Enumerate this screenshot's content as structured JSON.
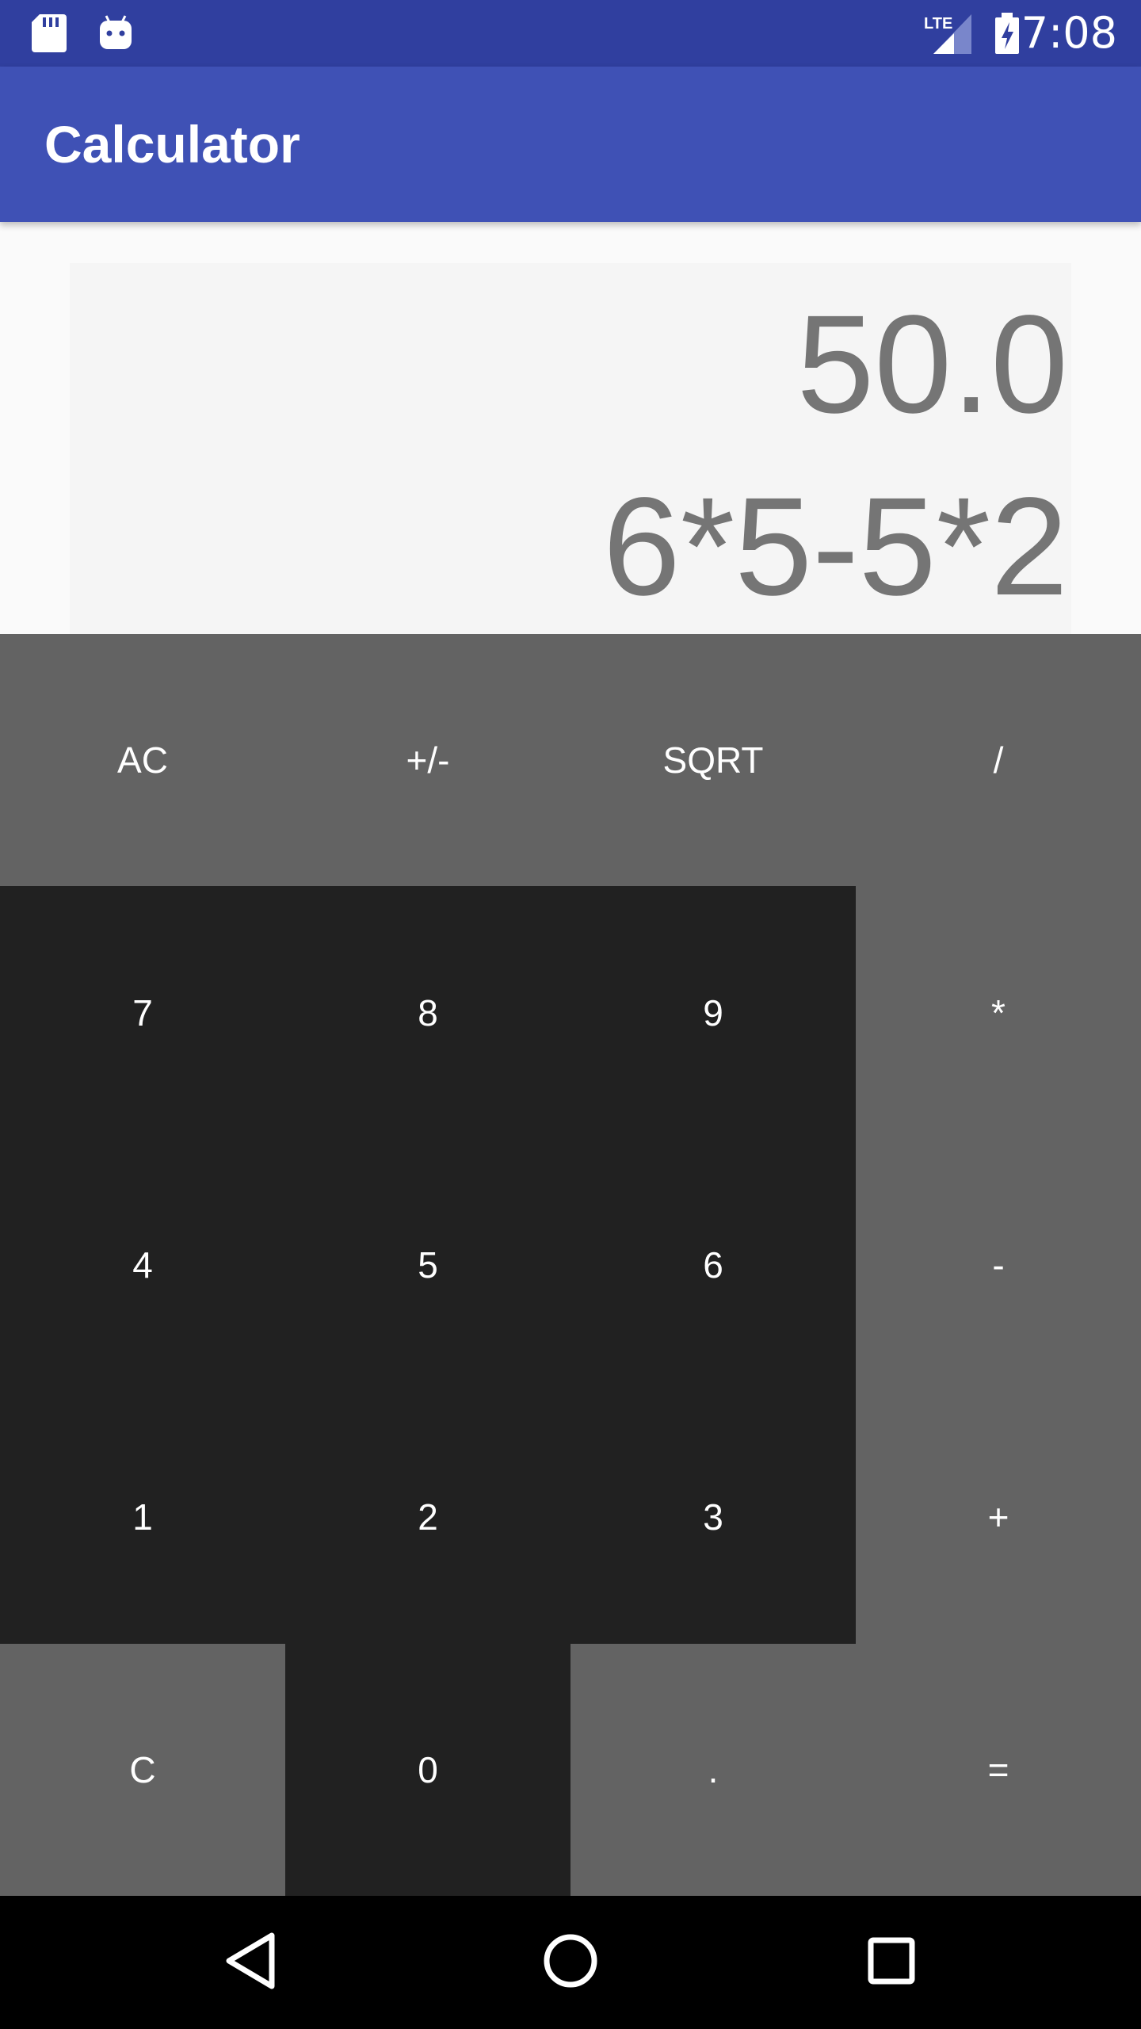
{
  "status_bar": {
    "time": "7:08",
    "network": "LTE",
    "icons": [
      "sd-card-icon",
      "android-icon",
      "lte-signal-icon",
      "battery-charging-icon"
    ]
  },
  "app_bar": {
    "title": "Calculator"
  },
  "display": {
    "result": "50.0",
    "expression": "6*5-5*2"
  },
  "keypad": {
    "keys": [
      {
        "label": "AC",
        "name": "ac-key"
      },
      {
        "label": "+/-",
        "name": "plus-minus-key"
      },
      {
        "label": "SQRT",
        "name": "sqrt-key"
      },
      {
        "label": "/",
        "name": "divide-key"
      },
      {
        "label": "7",
        "name": "digit-7-key"
      },
      {
        "label": "8",
        "name": "digit-8-key"
      },
      {
        "label": "9",
        "name": "digit-9-key"
      },
      {
        "label": "*",
        "name": "multiply-key"
      },
      {
        "label": "4",
        "name": "digit-4-key"
      },
      {
        "label": "5",
        "name": "digit-5-key"
      },
      {
        "label": "6",
        "name": "digit-6-key"
      },
      {
        "label": "-",
        "name": "subtract-key"
      },
      {
        "label": "1",
        "name": "digit-1-key"
      },
      {
        "label": "2",
        "name": "digit-2-key"
      },
      {
        "label": "3",
        "name": "digit-3-key"
      },
      {
        "label": "+",
        "name": "add-key"
      },
      {
        "label": "C",
        "name": "clear-key"
      },
      {
        "label": "0",
        "name": "digit-0-key"
      },
      {
        "label": ".",
        "name": "decimal-key"
      },
      {
        "label": "=",
        "name": "equals-key"
      }
    ]
  },
  "nav_bar": {
    "buttons": [
      "back-icon",
      "home-icon",
      "recents-icon"
    ]
  },
  "colors": {
    "status_bar": "#303f9f",
    "app_bar": "#3f51b5",
    "display_text": "#757575",
    "key_light": "#636363",
    "key_dark": "#212121"
  }
}
